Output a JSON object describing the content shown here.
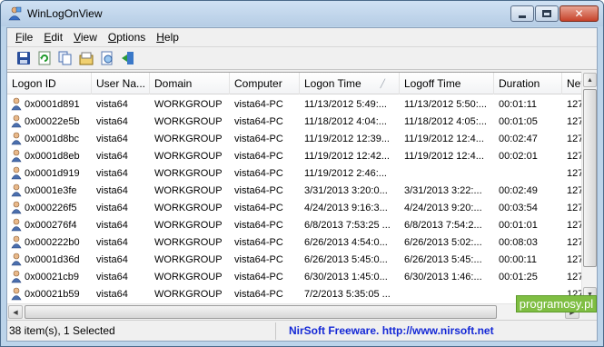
{
  "window": {
    "title": "WinLogOnView"
  },
  "menu": [
    {
      "key": "F",
      "rest": "ile"
    },
    {
      "key": "E",
      "rest": "dit"
    },
    {
      "key": "V",
      "rest": "iew"
    },
    {
      "key": "O",
      "rest": "ptions"
    },
    {
      "key": "H",
      "rest": "elp"
    }
  ],
  "toolbar": {
    "buttons": [
      "save-icon",
      "refresh-icon",
      "copy-icon",
      "properties-icon",
      "html-report-icon",
      "exit-icon"
    ]
  },
  "columns": [
    "Logon ID",
    "User Na...",
    "Domain",
    "Computer",
    "Logon Time",
    "Logoff Time",
    "Duration",
    "Net"
  ],
  "rows": [
    [
      "0x0001d891",
      "vista64",
      "WORKGROUP",
      "vista64-PC",
      "11/13/2012 5:49:...",
      "11/13/2012 5:50:...",
      "00:01:11",
      "127"
    ],
    [
      "0x00022e5b",
      "vista64",
      "WORKGROUP",
      "vista64-PC",
      "11/18/2012 4:04:...",
      "11/18/2012 4:05:...",
      "00:01:05",
      "127"
    ],
    [
      "0x0001d8bc",
      "vista64",
      "WORKGROUP",
      "vista64-PC",
      "11/19/2012 12:39...",
      "11/19/2012 12:4...",
      "00:02:47",
      "127"
    ],
    [
      "0x0001d8eb",
      "vista64",
      "WORKGROUP",
      "vista64-PC",
      "11/19/2012 12:42...",
      "11/19/2012 12:4...",
      "00:02:01",
      "127"
    ],
    [
      "0x0001d919",
      "vista64",
      "WORKGROUP",
      "vista64-PC",
      "11/19/2012 2:46:...",
      "",
      "",
      "127"
    ],
    [
      "0x0001e3fe",
      "vista64",
      "WORKGROUP",
      "vista64-PC",
      "3/31/2013 3:20:0...",
      "3/31/2013 3:22:...",
      "00:02:49",
      "127"
    ],
    [
      "0x000226f5",
      "vista64",
      "WORKGROUP",
      "vista64-PC",
      "4/24/2013 9:16:3...",
      "4/24/2013 9:20:...",
      "00:03:54",
      "127"
    ],
    [
      "0x000276f4",
      "vista64",
      "WORKGROUP",
      "vista64-PC",
      "6/8/2013 7:53:25 ...",
      "6/8/2013 7:54:2...",
      "00:01:01",
      "127"
    ],
    [
      "0x000222b0",
      "vista64",
      "WORKGROUP",
      "vista64-PC",
      "6/26/2013 4:54:0...",
      "6/26/2013 5:02:...",
      "00:08:03",
      "127"
    ],
    [
      "0x0001d36d",
      "vista64",
      "WORKGROUP",
      "vista64-PC",
      "6/26/2013 5:45:0...",
      "6/26/2013 5:45:...",
      "00:00:11",
      "127"
    ],
    [
      "0x00021cb9",
      "vista64",
      "WORKGROUP",
      "vista64-PC",
      "6/30/2013 1:45:0...",
      "6/30/2013 1:46:...",
      "00:01:25",
      "127"
    ],
    [
      "0x00021b59",
      "vista64",
      "WORKGROUP",
      "vista64-PC",
      "7/2/2013 5:35:05 ...",
      "",
      "",
      "127"
    ]
  ],
  "status": {
    "count": "38 item(s), 1 Selected",
    "link": "NirSoft Freeware.  http://www.nirsoft.net"
  },
  "watermark": "programosy.pl"
}
